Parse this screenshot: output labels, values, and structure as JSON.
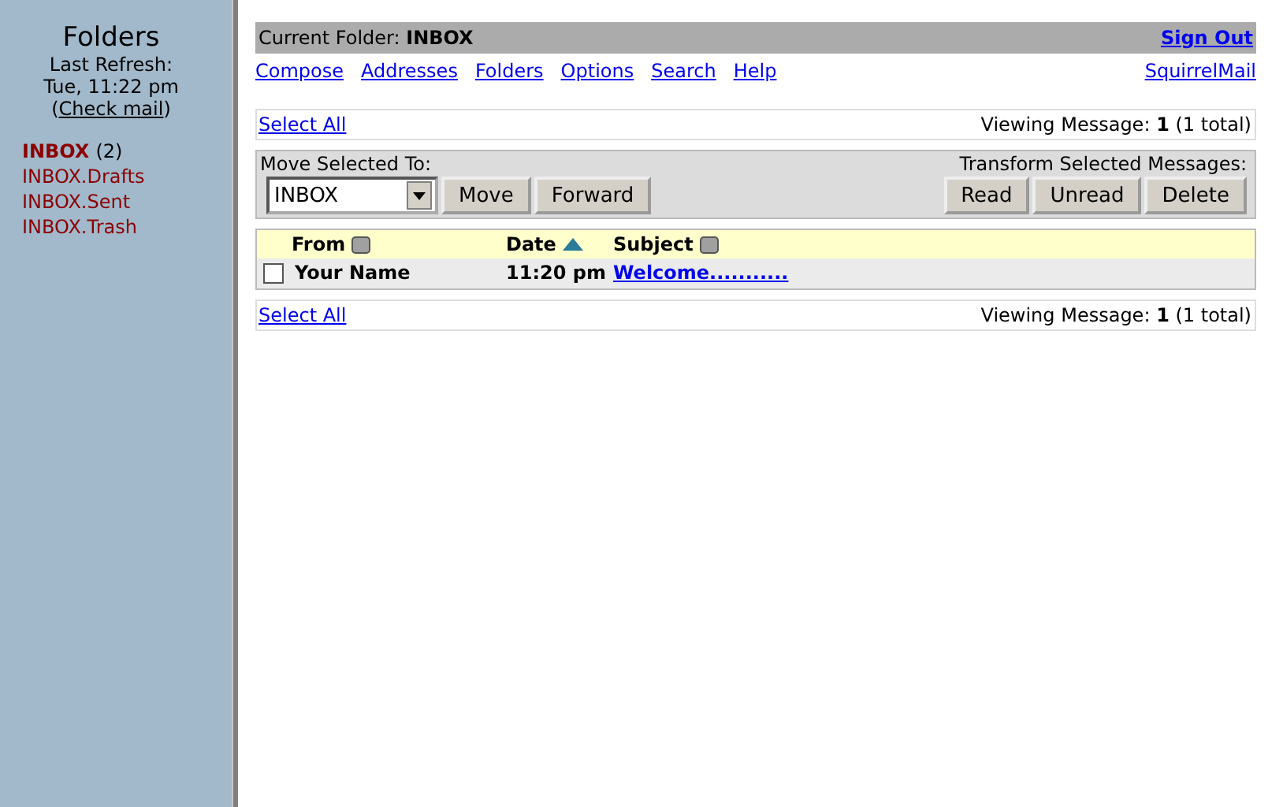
{
  "sidebar": {
    "title": "Folders",
    "refresh_label": "Last Refresh:",
    "refresh_time": "Tue, 11:22 pm",
    "check_mail": "Check mail",
    "check_open": "(",
    "check_close": ")",
    "folders": [
      {
        "name": "INBOX",
        "unread": true,
        "count": "(2)"
      },
      {
        "name": "INBOX.Drafts",
        "unread": false
      },
      {
        "name": "INBOX.Sent",
        "unread": false
      },
      {
        "name": "INBOX.Trash",
        "unread": false
      }
    ]
  },
  "header": {
    "current_label": "Current Folder:",
    "current": "INBOX",
    "sign_out": "Sign Out"
  },
  "nav": [
    "Compose",
    "Addresses",
    "Folders",
    "Options",
    "Search",
    "Help"
  ],
  "brand_link": "SquirrelMail",
  "top_bar": {
    "select_all": "Select All",
    "viewing": "Viewing Message: **1** (1 total)"
  },
  "actions": {
    "move_label": "Move Selected To:",
    "move_target": "INBOX",
    "move_buttons": [
      "Move",
      "Forward"
    ],
    "transform_label": "Transform Selected Messages:",
    "transform_buttons": [
      "Read",
      "Unread",
      "Delete"
    ]
  },
  "table": {
    "columns": [
      {
        "label": "From",
        "sorted": false
      },
      {
        "label": "Date",
        "sorted": true
      },
      {
        "label": "Subject",
        "sorted": false
      }
    ],
    "rows": [
      {
        "checked": false,
        "unread": true,
        "from": "Your Name",
        "date": "11:20 pm",
        "subject": "Welcome..........."
      }
    ]
  },
  "bottom_bar": {
    "select_all": "Select All",
    "viewing": "Viewing Message: **1** (1 total)"
  }
}
